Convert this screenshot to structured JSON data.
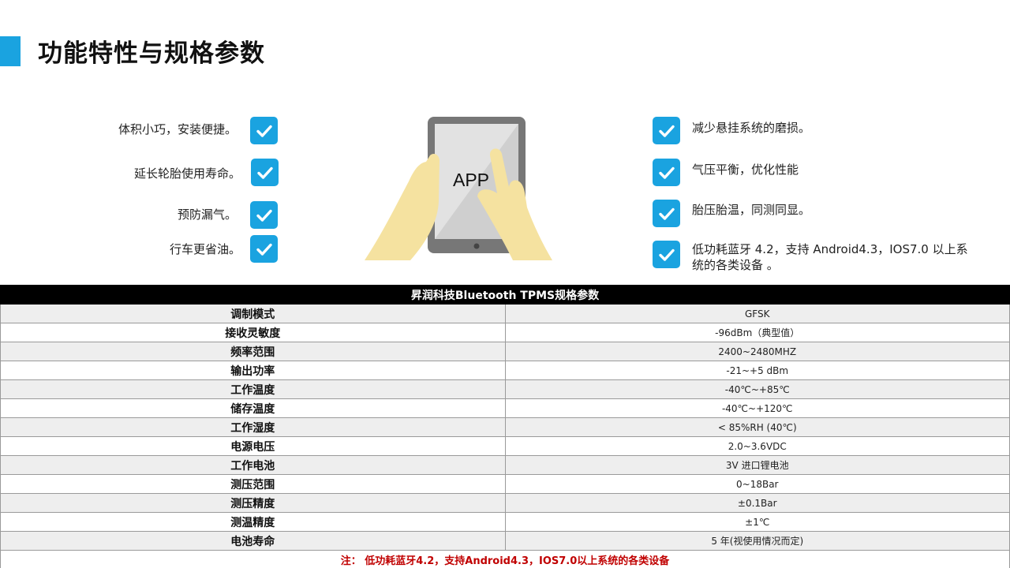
{
  "title": "功能特性与规格参数",
  "features_left": [
    "体积小巧，安装便捷。",
    "延长轮胎使用寿命。",
    "预防漏气。",
    "行车更省油。"
  ],
  "features_right": [
    "减少悬挂系统的磨损。",
    "气压平衡，优化性能",
    "胎压胎温，同测同显。",
    "低功耗蓝牙 4.2，支持 Android4.3，IOS7.0 以上系",
    "统的各类设备 。"
  ],
  "tablet_label": "APP",
  "table": {
    "header": "昇润科技Bluetooth TPMS规格参数",
    "rows": [
      {
        "label": "调制模式",
        "value": "GFSK"
      },
      {
        "label": "接收灵敏度",
        "value": "-96dBm（典型值）"
      },
      {
        "label": "频率范围",
        "value": "2400~2480MHZ"
      },
      {
        "label": "输出功率",
        "value": "-21~+5 dBm"
      },
      {
        "label": "工作温度",
        "value": "-40℃~+85℃"
      },
      {
        "label": "储存温度",
        "value": "-40℃~+120℃"
      },
      {
        "label": "工作湿度",
        "value": "< 85%RH (40℃)"
      },
      {
        "label": "电源电压",
        "value": "2.0~3.6VDC"
      },
      {
        "label": "工作电池",
        "value": "3V 进口锂电池"
      },
      {
        "label": "测压范围",
        "value": "0~18Bar"
      },
      {
        "label": "测压精度",
        "value": "±0.1Bar"
      },
      {
        "label": "测温精度",
        "value": "±1℃"
      },
      {
        "label": "电池寿命",
        "value": "5 年(视使用情况而定)"
      }
    ],
    "note": "注： 低功耗蓝牙4.2，支持Android4.3，IOS7.0以上系统的各类设备"
  },
  "colors": {
    "accent": "#1aa3e0",
    "note": "#c00000",
    "header_bg": "#000000",
    "hand": "#f5e2a0"
  },
  "icons": {
    "check": "checkmark-icon",
    "tablet": "tablet-hand-illustration"
  }
}
